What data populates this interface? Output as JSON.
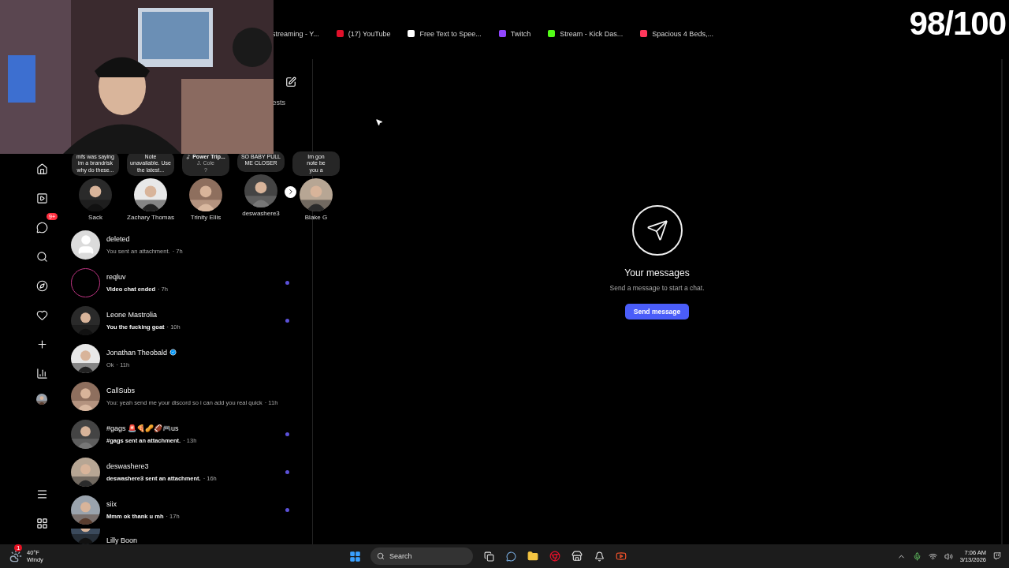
{
  "overlay": {
    "score": "98/100"
  },
  "bookmarks": [
    {
      "label": "streaming - Y..."
    },
    {
      "label": "(17) YouTube",
      "color": "#e0102a"
    },
    {
      "label": "Free Text to Spee...",
      "color": "#ffffff"
    },
    {
      "label": "Twitch",
      "color": "#9146ff"
    },
    {
      "label": "Stream - Kick Das...",
      "color": "#53fc18"
    },
    {
      "label": "Spacious 4 Beds,...",
      "color": "#ff385c"
    }
  ],
  "rail": {
    "badge": "9+"
  },
  "inbox": {
    "tab_fragment": "ests",
    "notes": [
      {
        "kind": "text",
        "lines": [
          "mfs was saying",
          "im a brandrisk",
          "why do these..."
        ],
        "name": "Sack"
      },
      {
        "kind": "text",
        "lines": [
          "Note",
          "unavailable. Use",
          "the latest..."
        ],
        "name": "Zachary Thomas"
      },
      {
        "kind": "music",
        "lines": [
          "Power Trip...",
          "J. Cole",
          "?"
        ],
        "name": "Trinity Ellis"
      },
      {
        "kind": "text",
        "lines": [
          "SO BABY PULL",
          "ME CLOSER"
        ],
        "name": "deswashere3"
      },
      {
        "kind": "text",
        "lines": [
          "Im gon",
          "note be",
          "you a"
        ],
        "name": "Blake G"
      }
    ],
    "conversations": [
      {
        "kind": "silhouette",
        "name": "deleted",
        "preview": "You sent an attachment.",
        "time": "· 7h",
        "unread": false,
        "verified": false
      },
      {
        "kind": "ring",
        "name": "reqluv",
        "preview": "Video chat ended",
        "time": "· 7h",
        "unread": true,
        "verified": false
      },
      {
        "kind": "picture",
        "name": "Leone Mastrolia",
        "preview": "You the fucking goat",
        "time": "· 10h",
        "unread": true,
        "verified": false
      },
      {
        "kind": "picture",
        "name": "Jonathan Theobald",
        "preview": "Ok",
        "time": "· 11h",
        "unread": false,
        "verified": true
      },
      {
        "kind": "picture",
        "name": "CallSubs",
        "preview": "You: yeah send me your discord so i can add you real quick",
        "time": "· 11h",
        "unread": false,
        "verified": false
      },
      {
        "kind": "picture",
        "name": "#gags 🚨🍕🥜🏈🎮us",
        "preview": "#gags sent an attachment.",
        "time": "· 13h",
        "unread": true,
        "verified": false
      },
      {
        "kind": "picture",
        "name": "deswashere3",
        "preview": "deswashere3 sent an attachment.",
        "time": "· 16h",
        "unread": true,
        "verified": false
      },
      {
        "kind": "picture",
        "name": "siix",
        "preview": "Mmm ok thank u mh",
        "time": "· 17h",
        "unread": true,
        "verified": false
      },
      {
        "kind": "picture",
        "name": "Lilly Boon"
      }
    ]
  },
  "empty_state": {
    "title": "Your messages",
    "subtitle": "Send a message to start a chat.",
    "button": "Send message"
  },
  "taskbar": {
    "weather_temp": "40°F",
    "weather_text": "Windy",
    "weather_badge": "1",
    "search": "Search",
    "time": "7:06 AM",
    "date": "3/13/2026"
  }
}
